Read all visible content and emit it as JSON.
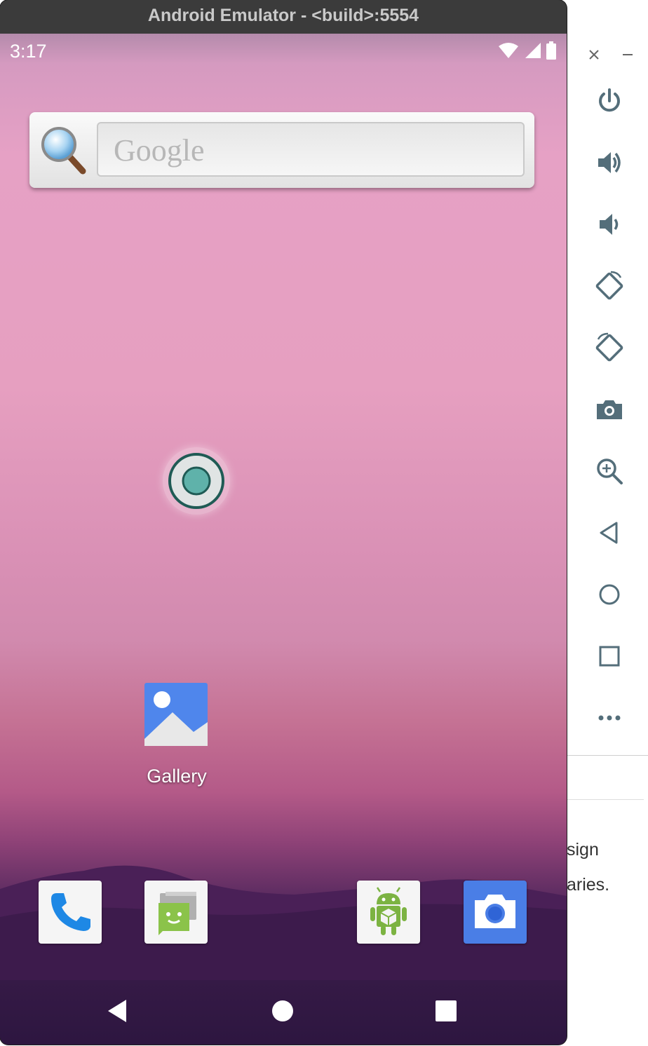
{
  "window": {
    "title": "Android Emulator - <build>:5554"
  },
  "status_bar": {
    "time": "3:17",
    "icons": [
      "wifi-icon",
      "cellular-signal-icon",
      "battery-icon"
    ]
  },
  "search_widget": {
    "placeholder": "Google",
    "icon": "magnifier-icon"
  },
  "home": {
    "apps": [
      {
        "label": "Gallery",
        "icon": "gallery-icon"
      }
    ],
    "dock": [
      "phone-icon",
      "messaging-icon",
      "android-app-icon",
      "camera-icon"
    ]
  },
  "nav_bar": [
    "back-icon",
    "home-icon",
    "overview-icon"
  ],
  "side_toolbar": {
    "window_controls": [
      "close-icon",
      "minimize-icon"
    ],
    "buttons": [
      "power-icon",
      "volume-up-icon",
      "volume-down-icon",
      "rotate-left-icon",
      "rotate-right-icon",
      "screenshot-camera-icon",
      "zoom-icon",
      "back-icon",
      "home-icon",
      "overview-icon",
      "more-icon"
    ]
  },
  "background_page": {
    "fragments": [
      "sign",
      "aries."
    ]
  },
  "colors": {
    "touch_indicator": "#5fb2aa",
    "gallery_blue": "#4f86ec",
    "phone_blue": "#1e88e5",
    "camera_blue": "#4a7ee6",
    "toolbar_icon": "#546e7a"
  }
}
